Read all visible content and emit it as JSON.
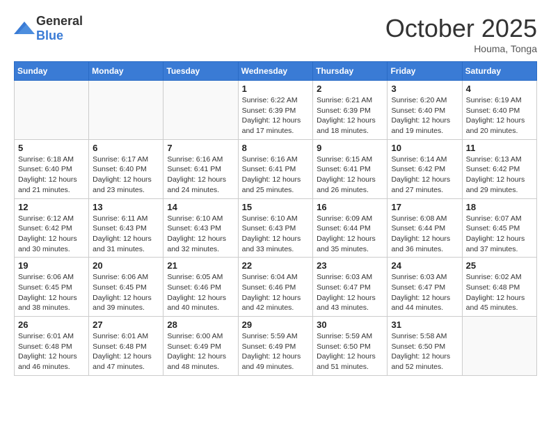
{
  "logo": {
    "general": "General",
    "blue": "Blue"
  },
  "title": "October 2025",
  "location": "Houma, Tonga",
  "days_header": [
    "Sunday",
    "Monday",
    "Tuesday",
    "Wednesday",
    "Thursday",
    "Friday",
    "Saturday"
  ],
  "weeks": [
    [
      {
        "day": "",
        "info": ""
      },
      {
        "day": "",
        "info": ""
      },
      {
        "day": "",
        "info": ""
      },
      {
        "day": "1",
        "info": "Sunrise: 6:22 AM\nSunset: 6:39 PM\nDaylight: 12 hours and 17 minutes."
      },
      {
        "day": "2",
        "info": "Sunrise: 6:21 AM\nSunset: 6:39 PM\nDaylight: 12 hours and 18 minutes."
      },
      {
        "day": "3",
        "info": "Sunrise: 6:20 AM\nSunset: 6:40 PM\nDaylight: 12 hours and 19 minutes."
      },
      {
        "day": "4",
        "info": "Sunrise: 6:19 AM\nSunset: 6:40 PM\nDaylight: 12 hours and 20 minutes."
      }
    ],
    [
      {
        "day": "5",
        "info": "Sunrise: 6:18 AM\nSunset: 6:40 PM\nDaylight: 12 hours and 21 minutes."
      },
      {
        "day": "6",
        "info": "Sunrise: 6:17 AM\nSunset: 6:40 PM\nDaylight: 12 hours and 23 minutes."
      },
      {
        "day": "7",
        "info": "Sunrise: 6:16 AM\nSunset: 6:41 PM\nDaylight: 12 hours and 24 minutes."
      },
      {
        "day": "8",
        "info": "Sunrise: 6:16 AM\nSunset: 6:41 PM\nDaylight: 12 hours and 25 minutes."
      },
      {
        "day": "9",
        "info": "Sunrise: 6:15 AM\nSunset: 6:41 PM\nDaylight: 12 hours and 26 minutes."
      },
      {
        "day": "10",
        "info": "Sunrise: 6:14 AM\nSunset: 6:42 PM\nDaylight: 12 hours and 27 minutes."
      },
      {
        "day": "11",
        "info": "Sunrise: 6:13 AM\nSunset: 6:42 PM\nDaylight: 12 hours and 29 minutes."
      }
    ],
    [
      {
        "day": "12",
        "info": "Sunrise: 6:12 AM\nSunset: 6:42 PM\nDaylight: 12 hours and 30 minutes."
      },
      {
        "day": "13",
        "info": "Sunrise: 6:11 AM\nSunset: 6:43 PM\nDaylight: 12 hours and 31 minutes."
      },
      {
        "day": "14",
        "info": "Sunrise: 6:10 AM\nSunset: 6:43 PM\nDaylight: 12 hours and 32 minutes."
      },
      {
        "day": "15",
        "info": "Sunrise: 6:10 AM\nSunset: 6:43 PM\nDaylight: 12 hours and 33 minutes."
      },
      {
        "day": "16",
        "info": "Sunrise: 6:09 AM\nSunset: 6:44 PM\nDaylight: 12 hours and 35 minutes."
      },
      {
        "day": "17",
        "info": "Sunrise: 6:08 AM\nSunset: 6:44 PM\nDaylight: 12 hours and 36 minutes."
      },
      {
        "day": "18",
        "info": "Sunrise: 6:07 AM\nSunset: 6:45 PM\nDaylight: 12 hours and 37 minutes."
      }
    ],
    [
      {
        "day": "19",
        "info": "Sunrise: 6:06 AM\nSunset: 6:45 PM\nDaylight: 12 hours and 38 minutes."
      },
      {
        "day": "20",
        "info": "Sunrise: 6:06 AM\nSunset: 6:45 PM\nDaylight: 12 hours and 39 minutes."
      },
      {
        "day": "21",
        "info": "Sunrise: 6:05 AM\nSunset: 6:46 PM\nDaylight: 12 hours and 40 minutes."
      },
      {
        "day": "22",
        "info": "Sunrise: 6:04 AM\nSunset: 6:46 PM\nDaylight: 12 hours and 42 minutes."
      },
      {
        "day": "23",
        "info": "Sunrise: 6:03 AM\nSunset: 6:47 PM\nDaylight: 12 hours and 43 minutes."
      },
      {
        "day": "24",
        "info": "Sunrise: 6:03 AM\nSunset: 6:47 PM\nDaylight: 12 hours and 44 minutes."
      },
      {
        "day": "25",
        "info": "Sunrise: 6:02 AM\nSunset: 6:48 PM\nDaylight: 12 hours and 45 minutes."
      }
    ],
    [
      {
        "day": "26",
        "info": "Sunrise: 6:01 AM\nSunset: 6:48 PM\nDaylight: 12 hours and 46 minutes."
      },
      {
        "day": "27",
        "info": "Sunrise: 6:01 AM\nSunset: 6:48 PM\nDaylight: 12 hours and 47 minutes."
      },
      {
        "day": "28",
        "info": "Sunrise: 6:00 AM\nSunset: 6:49 PM\nDaylight: 12 hours and 48 minutes."
      },
      {
        "day": "29",
        "info": "Sunrise: 5:59 AM\nSunset: 6:49 PM\nDaylight: 12 hours and 49 minutes."
      },
      {
        "day": "30",
        "info": "Sunrise: 5:59 AM\nSunset: 6:50 PM\nDaylight: 12 hours and 51 minutes."
      },
      {
        "day": "31",
        "info": "Sunrise: 5:58 AM\nSunset: 6:50 PM\nDaylight: 12 hours and 52 minutes."
      },
      {
        "day": "",
        "info": ""
      }
    ]
  ]
}
